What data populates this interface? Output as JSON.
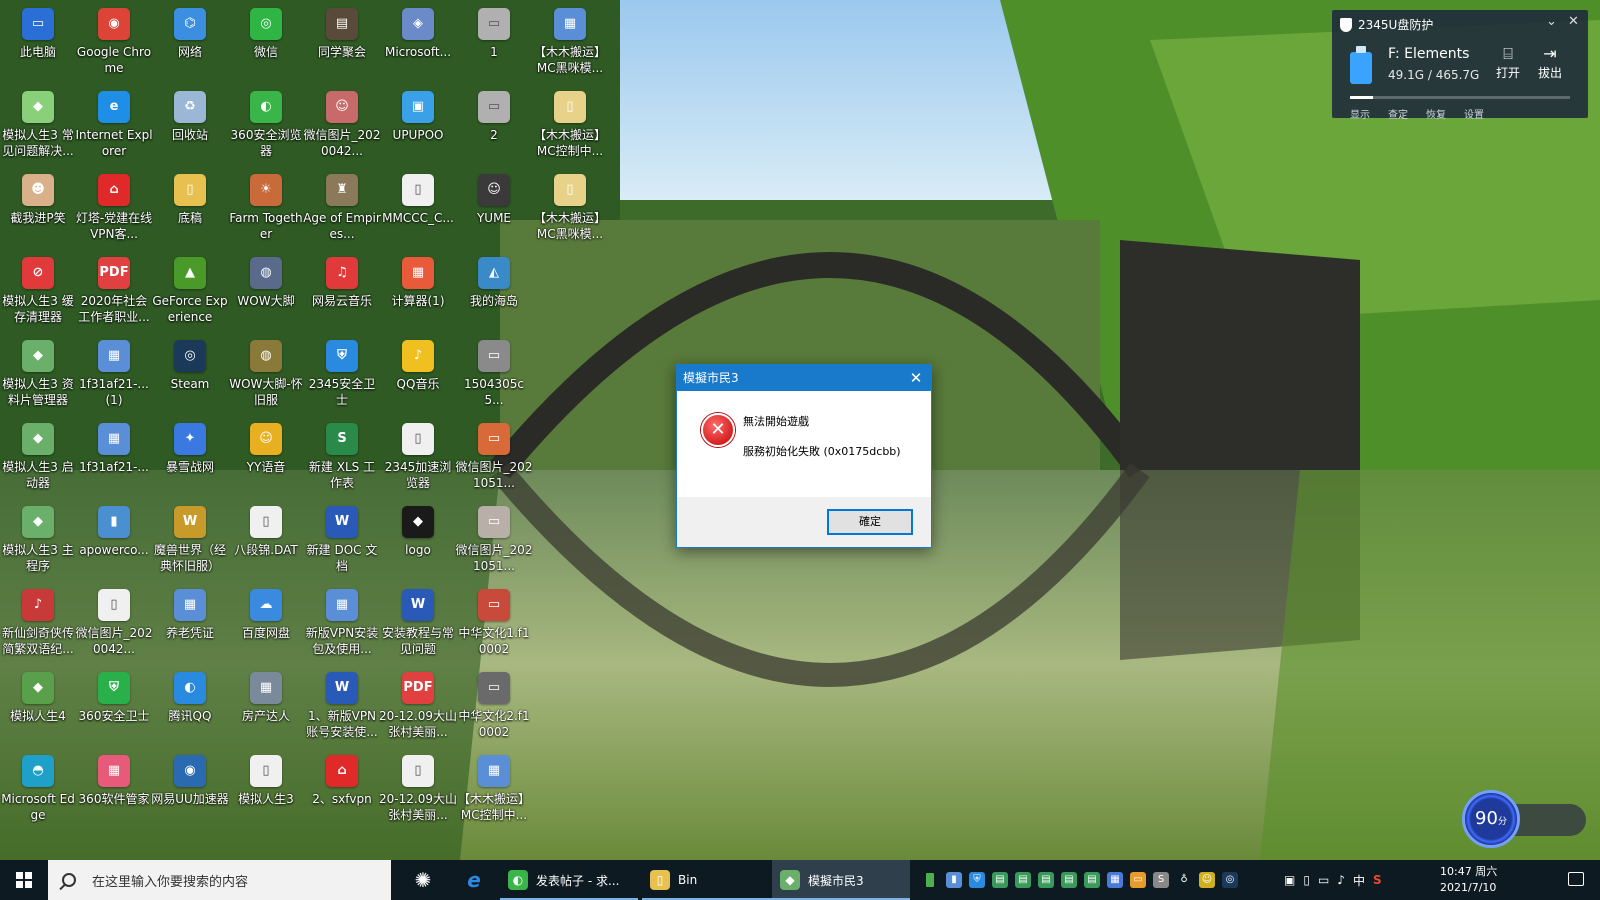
{
  "desktop": {
    "icons": [
      {
        "label": "此电脑",
        "color": "#2a6fd6",
        "glyph": "▭",
        "col": 0,
        "row": 0
      },
      {
        "label": "Google Chrome",
        "color": "#db4437",
        "glyph": "◉",
        "col": 1,
        "row": 0
      },
      {
        "label": "网络",
        "color": "#3c8ee0",
        "glyph": "⌬",
        "col": 2,
        "row": 0
      },
      {
        "label": "微信",
        "color": "#2fb544",
        "glyph": "◎",
        "col": 3,
        "row": 0
      },
      {
        "label": "同学聚会",
        "color": "#5a4a3a",
        "glyph": "▤",
        "col": 4,
        "row": 0
      },
      {
        "label": "Microsoft...",
        "color": "#6b8bc8",
        "glyph": "◈",
        "col": 5,
        "row": 0
      },
      {
        "label": "1",
        "color": "#b0b0b0",
        "glyph": "▭",
        "col": 6,
        "row": 0
      },
      {
        "label": "【木木搬运】MC黑咪模...",
        "color": "#5a8fd8",
        "glyph": "▦",
        "col": 7,
        "row": 0
      },
      {
        "label": "模拟人生3 常见问题解决...",
        "color": "#8ad07a",
        "glyph": "◆",
        "col": 0,
        "row": 1
      },
      {
        "label": "Internet Explorer",
        "color": "#1f8ee6",
        "glyph": "e",
        "col": 1,
        "row": 1
      },
      {
        "label": "回收站",
        "color": "#9ab8d6",
        "glyph": "♻",
        "col": 2,
        "row": 1
      },
      {
        "label": "360安全浏览器",
        "color": "#39b54a",
        "glyph": "◐",
        "col": 3,
        "row": 1
      },
      {
        "label": "微信图片_2020042...",
        "color": "#c86a6a",
        "glyph": "☺",
        "col": 4,
        "row": 1
      },
      {
        "label": "UPUPOO",
        "color": "#3aa0e8",
        "glyph": "▣",
        "col": 5,
        "row": 1
      },
      {
        "label": "2",
        "color": "#b0b0b0",
        "glyph": "▭",
        "col": 6,
        "row": 1
      },
      {
        "label": "【木木搬运】MC控制中...",
        "color": "#e8d28a",
        "glyph": "▯",
        "col": 7,
        "row": 1
      },
      {
        "label": "截我进P笑",
        "color": "#d8b08a",
        "glyph": "☻",
        "col": 0,
        "row": 2
      },
      {
        "label": "灯塔-党建在线 VPN客...",
        "color": "#e02a2a",
        "glyph": "⌂",
        "col": 1,
        "row": 2
      },
      {
        "label": "底稿",
        "color": "#e8c050",
        "glyph": "▯",
        "col": 2,
        "row": 2
      },
      {
        "label": "Farm Together",
        "color": "#c86a3a",
        "glyph": "☀",
        "col": 3,
        "row": 2
      },
      {
        "label": "Age of Empires...",
        "color": "#8a7a5a",
        "glyph": "♜",
        "col": 4,
        "row": 2
      },
      {
        "label": "MMCCC_C...",
        "color": "#f0f0f0",
        "glyph": "▯",
        "col": 5,
        "row": 2
      },
      {
        "label": "YUME",
        "color": "#3a3a3a",
        "glyph": "☺",
        "col": 6,
        "row": 2
      },
      {
        "label": "【木木搬运】MC黑咪模...",
        "color": "#e8d28a",
        "glyph": "▯",
        "col": 7,
        "row": 2
      },
      {
        "label": "模拟人生3 缓存清理器",
        "color": "#e03a3a",
        "glyph": "⊘",
        "col": 0,
        "row": 3
      },
      {
        "label": "2020年社会工作者职业...",
        "color": "#e04040",
        "glyph": "PDF",
        "col": 1,
        "row": 3
      },
      {
        "label": "GeForce Experience",
        "color": "#4a9a2a",
        "glyph": "▲",
        "col": 2,
        "row": 3
      },
      {
        "label": "WOW大脚",
        "color": "#5a6a8a",
        "glyph": "◍",
        "col": 3,
        "row": 3
      },
      {
        "label": "网易云音乐",
        "color": "#e03a3a",
        "glyph": "♫",
        "col": 4,
        "row": 3
      },
      {
        "label": "计算器(1)",
        "color": "#e85a3a",
        "glyph": "▦",
        "col": 5,
        "row": 3
      },
      {
        "label": "我的海岛",
        "color": "#3a8ac8",
        "glyph": "◭",
        "col": 6,
        "row": 3
      },
      {
        "label": "模拟人生3 资料片管理器",
        "color": "#6ab06a",
        "glyph": "◆",
        "col": 0,
        "row": 4
      },
      {
        "label": "1f31af21-...(1)",
        "color": "#5a8fd8",
        "glyph": "▦",
        "col": 1,
        "row": 4
      },
      {
        "label": "Steam",
        "color": "#1b3a5a",
        "glyph": "◎",
        "col": 2,
        "row": 4
      },
      {
        "label": "WOW大脚-怀旧服",
        "color": "#8a7a3a",
        "glyph": "◍",
        "col": 3,
        "row": 4
      },
      {
        "label": "2345安全卫士",
        "color": "#2a8ae0",
        "glyph": "⛨",
        "col": 4,
        "row": 4
      },
      {
        "label": "QQ音乐",
        "color": "#f0c020",
        "glyph": "♪",
        "col": 5,
        "row": 4
      },
      {
        "label": "1504305c5...",
        "color": "#8a8a8a",
        "glyph": "▭",
        "col": 6,
        "row": 4
      },
      {
        "label": "模拟人生3 启动器",
        "color": "#6ab06a",
        "glyph": "◆",
        "col": 0,
        "row": 5
      },
      {
        "label": "1f31af21-...",
        "color": "#5a8fd8",
        "glyph": "▦",
        "col": 1,
        "row": 5
      },
      {
        "label": "暴雪战网",
        "color": "#3a7ae0",
        "glyph": "✦",
        "col": 2,
        "row": 5
      },
      {
        "label": "YY语音",
        "color": "#e8b020",
        "glyph": "☺",
        "col": 3,
        "row": 5
      },
      {
        "label": "新建 XLS 工作表",
        "color": "#2a8a4a",
        "glyph": "S",
        "col": 4,
        "row": 5
      },
      {
        "label": "2345加速浏览器",
        "color": "#f0f0f0",
        "glyph": "▯",
        "col": 5,
        "row": 5
      },
      {
        "label": "微信图片_2021051...",
        "color": "#d86a3a",
        "glyph": "▭",
        "col": 6,
        "row": 5
      },
      {
        "label": "模拟人生3 主程序",
        "color": "#6ab06a",
        "glyph": "◆",
        "col": 0,
        "row": 6
      },
      {
        "label": "apowerco...",
        "color": "#4a90d0",
        "glyph": "▮",
        "col": 1,
        "row": 6
      },
      {
        "label": "魔兽世界（经典怀旧服）",
        "color": "#c89a2a",
        "glyph": "W",
        "col": 2,
        "row": 6
      },
      {
        "label": "八段锦.DAT",
        "color": "#f0f0f0",
        "glyph": "▯",
        "col": 3,
        "row": 6
      },
      {
        "label": "新建 DOC 文档",
        "color": "#2a5ab8",
        "glyph": "W",
        "col": 4,
        "row": 6
      },
      {
        "label": "logo",
        "color": "#1a1a1a",
        "glyph": "◆",
        "col": 5,
        "row": 6
      },
      {
        "label": "微信图片_2021051...",
        "color": "#b8b0a8",
        "glyph": "▭",
        "col": 6,
        "row": 6
      },
      {
        "label": "新仙剑奇侠传简繁双语纪...",
        "color": "#c83a3a",
        "glyph": "♪",
        "col": 0,
        "row": 7
      },
      {
        "label": "微信图片_2020042...",
        "color": "#f0f0f0",
        "glyph": "▯",
        "col": 1,
        "row": 7
      },
      {
        "label": "养老凭证",
        "color": "#5a8fd8",
        "glyph": "▦",
        "col": 2,
        "row": 7
      },
      {
        "label": "百度网盘",
        "color": "#3a8ae0",
        "glyph": "☁",
        "col": 3,
        "row": 7
      },
      {
        "label": "新版VPN安装包及使用...",
        "color": "#5a8fd8",
        "glyph": "▦",
        "col": 4,
        "row": 7
      },
      {
        "label": "安装教程与常见问题",
        "color": "#2a5ab8",
        "glyph": "W",
        "col": 5,
        "row": 7
      },
      {
        "label": "中华文化1.f10002",
        "color": "#c84a3a",
        "glyph": "▭",
        "col": 6,
        "row": 7
      },
      {
        "label": "模拟人生4",
        "color": "#5aa04a",
        "glyph": "◆",
        "col": 0,
        "row": 8
      },
      {
        "label": "360安全卫士",
        "color": "#2ab04a",
        "glyph": "⛨",
        "col": 1,
        "row": 8
      },
      {
        "label": "腾讯QQ",
        "color": "#2a8ae0",
        "glyph": "◐",
        "col": 2,
        "row": 8
      },
      {
        "label": "房产达人",
        "color": "#7a8a9a",
        "glyph": "▦",
        "col": 3,
        "row": 8
      },
      {
        "label": "1、新版VPN账号安装使...",
        "color": "#2a5ab8",
        "glyph": "W",
        "col": 4,
        "row": 8
      },
      {
        "label": "20-12.09大山张村美丽...",
        "color": "#e04040",
        "glyph": "PDF",
        "col": 5,
        "row": 8
      },
      {
        "label": "中华文化2.f10002",
        "color": "#6a6a6a",
        "glyph": "▭",
        "col": 6,
        "row": 8
      },
      {
        "label": "Microsoft Edge",
        "color": "#1fa0c8",
        "glyph": "◓",
        "col": 0,
        "row": 9
      },
      {
        "label": "360软件管家",
        "color": "#e85a7a",
        "glyph": "▦",
        "col": 1,
        "row": 9
      },
      {
        "label": "网易UU加速器",
        "color": "#2a6ab0",
        "glyph": "◉",
        "col": 2,
        "row": 9
      },
      {
        "label": "模拟人生3",
        "color": "#f0f0f0",
        "glyph": "▯",
        "col": 3,
        "row": 9
      },
      {
        "label": "2、sxfvpn",
        "color": "#e02a2a",
        "glyph": "⌂",
        "col": 4,
        "row": 9
      },
      {
        "label": "20-12.09大山张村美丽...",
        "color": "#f0f0f0",
        "glyph": "▯",
        "col": 5,
        "row": 9
      },
      {
        "label": "【木木搬运】MC控制中...",
        "color": "#5a8fd8",
        "glyph": "▦",
        "col": 6,
        "row": 9
      }
    ]
  },
  "usb_panel": {
    "title": "2345U盘防护",
    "drive_name": "F:  Elements",
    "drive_size": "49.1G / 465.7G",
    "used_fraction": 0.105,
    "open_label": "打开",
    "eject_label": "拔出",
    "footer": [
      "显示",
      "查定",
      "恢复",
      "设置"
    ]
  },
  "dialog": {
    "title": "模擬市民3",
    "message": "無法開始遊戲",
    "detail": "服務初始化失敗 (0x0175dcbb)",
    "ok_label": "確定"
  },
  "perf_widget": {
    "score": "90",
    "unit": "分"
  },
  "taskbar": {
    "search_placeholder": "在这里输入你要搜索的内容",
    "apps": [
      {
        "label": "发表帖子 - 求...",
        "color": "#3ab54a",
        "glyph": "◐"
      },
      {
        "label": "Bin",
        "color": "#e8c050",
        "glyph": "▯"
      },
      {
        "label": "模擬市民3",
        "color": "#6ab06a",
        "glyph": "◆"
      }
    ],
    "ime": "中",
    "clock_time": "10:47 周六",
    "clock_date": "2021/7/10"
  }
}
